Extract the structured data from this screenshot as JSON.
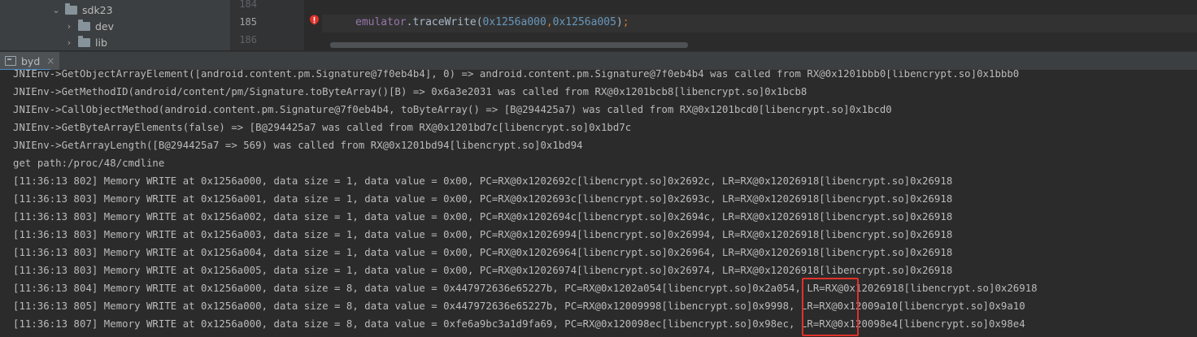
{
  "project_tree": {
    "items": [
      {
        "label": "sdk23",
        "expanded": true
      },
      {
        "label": "dev",
        "expanded": false
      },
      {
        "label": "lib",
        "expanded": false
      }
    ]
  },
  "editor": {
    "line_numbers": [
      "184",
      "185",
      "186"
    ],
    "code": {
      "object": "emulator",
      "method": ".traceWrite(",
      "arg1": "0x1256a000",
      "comma": ",",
      "arg2": "0x1256a005",
      "close": ")",
      "semicolon": ";"
    }
  },
  "run_tab": {
    "label": "byd",
    "close": "×"
  },
  "console_lines": [
    "JNIEnv->GetObjectArrayElement([android.content.pm.Signature@7f0eb4b4], 0) => android.content.pm.Signature@7f0eb4b4 was called from RX@0x1201bbb0[libencrypt.so]0x1bbb0",
    "JNIEnv->GetMethodID(android/content/pm/Signature.toByteArray()[B) => 0x6a3e2031 was called from RX@0x1201bcb8[libencrypt.so]0x1bcb8",
    "JNIEnv->CallObjectMethod(android.content.pm.Signature@7f0eb4b4, toByteArray() => [B@294425a7) was called from RX@0x1201bcd0[libencrypt.so]0x1bcd0",
    "JNIEnv->GetByteArrayElements(false) => [B@294425a7 was called from RX@0x1201bd7c[libencrypt.so]0x1bd7c",
    "JNIEnv->GetArrayLength([B@294425a7 => 569) was called from RX@0x1201bd94[libencrypt.so]0x1bd94",
    "get path:/proc/48/cmdline",
    "[11:36:13 802] Memory WRITE at 0x1256a000, data size = 1, data value = 0x00, PC=RX@0x1202692c[libencrypt.so]0x2692c, LR=RX@0x12026918[libencrypt.so]0x26918",
    "[11:36:13 803] Memory WRITE at 0x1256a001, data size = 1, data value = 0x00, PC=RX@0x1202693c[libencrypt.so]0x2693c, LR=RX@0x12026918[libencrypt.so]0x26918",
    "[11:36:13 803] Memory WRITE at 0x1256a002, data size = 1, data value = 0x00, PC=RX@0x1202694c[libencrypt.so]0x2694c, LR=RX@0x12026918[libencrypt.so]0x26918",
    "[11:36:13 803] Memory WRITE at 0x1256a003, data size = 1, data value = 0x00, PC=RX@0x12026994[libencrypt.so]0x26994, LR=RX@0x12026918[libencrypt.so]0x26918",
    "[11:36:13 803] Memory WRITE at 0x1256a004, data size = 1, data value = 0x00, PC=RX@0x12026964[libencrypt.so]0x26964, LR=RX@0x12026918[libencrypt.so]0x26918",
    "[11:36:13 803] Memory WRITE at 0x1256a005, data size = 1, data value = 0x00, PC=RX@0x12026974[libencrypt.so]0x26974, LR=RX@0x12026918[libencrypt.so]0x26918",
    "[11:36:13 804] Memory WRITE at 0x1256a000, data size = 8, data value = 0x447972636e65227b, PC=RX@0x1202a054[libencrypt.so]0x2a054, LR=RX@0x12026918[libencrypt.so]0x26918",
    "[11:36:13 805] Memory WRITE at 0x1256a000, data size = 8, data value = 0x447972636e65227b, PC=RX@0x12009998[libencrypt.so]0x9998, LR=RX@0x12009a10[libencrypt.so]0x9a10",
    "[11:36:13 807] Memory WRITE at 0x1256a000, data size = 8, data value = 0xfe6a9bc3a1d9fa69, PC=RX@0x120098ec[libencrypt.so]0x98ec, LR=RX@0x120098e4[libencrypt.so]0x98e4"
  ],
  "colors": {
    "background": "#2b2b2b",
    "console_text": "#bbbbbb",
    "highlight_box": "#e0312a",
    "breakpoint": "#e0312a"
  }
}
